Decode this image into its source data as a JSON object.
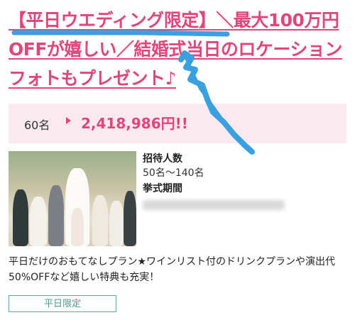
{
  "plan": {
    "title": "【平日ウエディング限定】＼最大100万円OFFが嬉しい／結婚式当日のロケーションフォトもプレゼント♪",
    "guests": "60名",
    "price": "2,418,986円!!",
    "invite_label": "招待人数",
    "invite_value": "50名〜140名",
    "period_label": "挙式期間",
    "description": "平日だけのおもてなしプラン★ワインリスト付のドリンクプランや演出代50%OFFなど嬉しい特典も充実！",
    "tag": "平日限定"
  },
  "colors": {
    "accent": "#e0457b",
    "tag": "#5aa79b",
    "price_bg": "#fbe9f0",
    "annotation": "#3aa0e0"
  }
}
